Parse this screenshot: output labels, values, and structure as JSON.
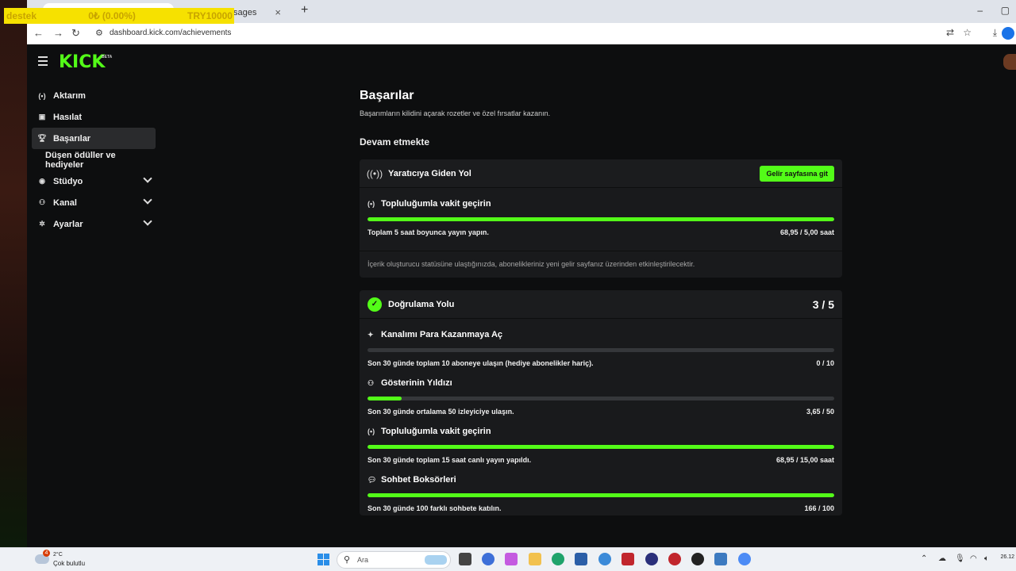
{
  "browser": {
    "tabs": [
      {
        "label": ""
      },
      {
        "label": "sages"
      }
    ],
    "new_tab": "+",
    "url": "dashboard.kick.com/achievements",
    "window_controls": {
      "minimize": "–",
      "restore": "▢"
    }
  },
  "ticker": {
    "name": "destek",
    "change": "0₺ (0.00%)",
    "target": "TRY10000"
  },
  "kick": {
    "logo": "KICK",
    "beta": "BETA",
    "sidebar": {
      "items": [
        {
          "label": "Aktarım",
          "icon": "broadcast-icon"
        },
        {
          "label": "Hasılat",
          "icon": "chart-icon"
        },
        {
          "label": "Başarılar",
          "icon": "trophy-icon"
        },
        {
          "label": "Düşen ödüller ve hediyeler"
        },
        {
          "label": "Stüdyo",
          "icon": "studio-icon"
        },
        {
          "label": "Kanal",
          "icon": "users-icon"
        },
        {
          "label": "Ayarlar",
          "icon": "gear-icon"
        }
      ]
    },
    "main": {
      "title": "Başarılar",
      "subtitle": "Başarımların kilidini açarak rozetler ve özel fırsatlar kazanın.",
      "section_title": "Devam etmekte",
      "cards": [
        {
          "title": "Yaratıcıya Giden Yol",
          "button": "Gelir sayfasına git",
          "goals": [
            {
              "title": "Topluluğumla vakit geçirin",
              "description": "Toplam 5 saat boyunca yayın yapın.",
              "progress_text": "68,95 / 5,00 saat",
              "progress": 1.0
            }
          ],
          "note": "İçerik oluşturucu statüsüne ulaştığınızda, abonelikleriniz yeni gelir sayfanız üzerinden etkinleştirilecektir."
        },
        {
          "title": "Doğrulama Yolu",
          "count": "3 / 5",
          "goals": [
            {
              "title": "Kanalımı Para Kazanmaya Aç",
              "description": "Son 30 günde toplam 10 aboneye ulaşın (hediye abonelikler hariç).",
              "progress_text": "0 / 10",
              "progress": 0.0
            },
            {
              "title": "Gösterinin Yıldızı",
              "description": "Son 30 günde ortalama 50 izleyiciye ulaşın.",
              "progress_text": "3,65 / 50",
              "progress": 0.073
            },
            {
              "title": "Topluluğumla vakit geçirin",
              "description": "Son 30 günde toplam 15 saat canlı yayın yapıldı.",
              "progress_text": "68,95 / 15,00 saat",
              "progress": 1.0
            },
            {
              "title": "Sohbet Boksörleri",
              "description": "Son 30 günde 100 farklı sohbete katılın.",
              "progress_text": "166 / 100",
              "progress": 1.0
            }
          ]
        }
      ]
    }
  },
  "taskbar": {
    "weather_badge": "4",
    "weather_temp": "2°C",
    "weather_desc": "Çok bulutlu",
    "search_placeholder": "Ara",
    "clock": "26.12"
  },
  "colors": {
    "accent": "#53fc18",
    "bg": "#0d0e0f",
    "card": "#191a1c"
  }
}
